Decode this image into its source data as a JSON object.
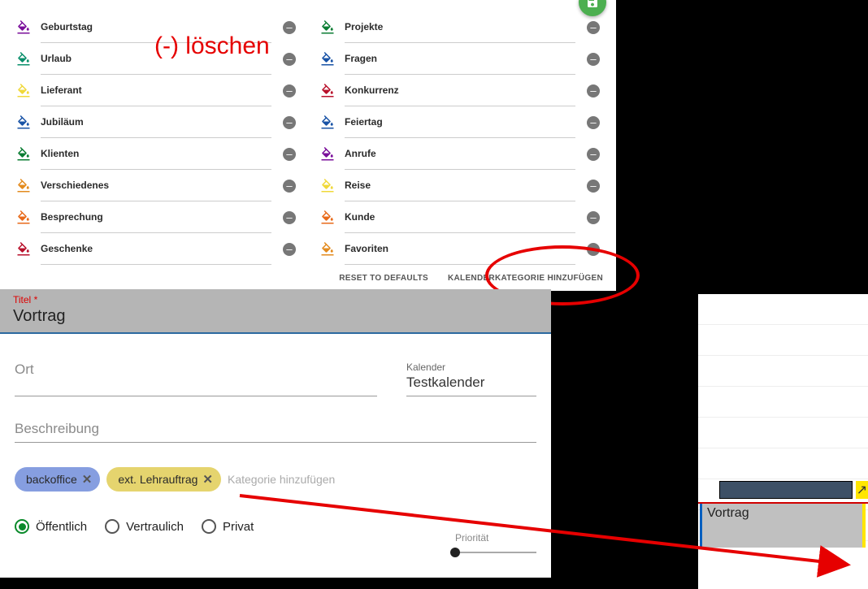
{
  "annotations": {
    "delete_label": "(-) löschen"
  },
  "categories": {
    "left": [
      {
        "label": "Geburtstag",
        "color": "#7a0e9a"
      },
      {
        "label": "Urlaub",
        "color": "#0a8f6b"
      },
      {
        "label": "Lieferant",
        "color": "#f0d83a"
      },
      {
        "label": "Jubiläum",
        "color": "#1953a6"
      },
      {
        "label": "Klienten",
        "color": "#0b7d33"
      },
      {
        "label": "Verschiedenes",
        "color": "#e38b1e"
      },
      {
        "label": "Besprechung",
        "color": "#e86a1a"
      },
      {
        "label": "Geschenke",
        "color": "#b8102b"
      }
    ],
    "right": [
      {
        "label": "Projekte",
        "color": "#0b7d33"
      },
      {
        "label": "Fragen",
        "color": "#1953a6"
      },
      {
        "label": "Konkurrenz",
        "color": "#b8102b"
      },
      {
        "label": "Feiertag",
        "color": "#1953a6"
      },
      {
        "label": "Anrufe",
        "color": "#7a0e9a"
      },
      {
        "label": "Reise",
        "color": "#f0d83a"
      },
      {
        "label": "Kunde",
        "color": "#e86a1a"
      },
      {
        "label": "Favoriten",
        "color": "#e38b1e"
      }
    ]
  },
  "panel_footer": {
    "reset": "RESET TO DEFAULTS",
    "add": "KALENDERKATEGORIE HINZUFÜGEN"
  },
  "form": {
    "title_label": "Titel",
    "title_value": "Vortrag",
    "ort_label": "Ort",
    "ort_value": "",
    "calendar_label": "Kalender",
    "calendar_value": "Testkalender",
    "desc_label": "Beschreibung",
    "desc_value": "",
    "chips": {
      "backoffice": "backoffice",
      "lehrauftrag": "ext. Lehrauftrag",
      "add_placeholder": "Kategorie hinzufügen"
    },
    "visibility": {
      "public": "Öffentlich",
      "conf": "Vertraulich",
      "privat": "Privat"
    },
    "priority_label": "Priorität"
  },
  "daycal": {
    "event_title": "Vortrag"
  }
}
